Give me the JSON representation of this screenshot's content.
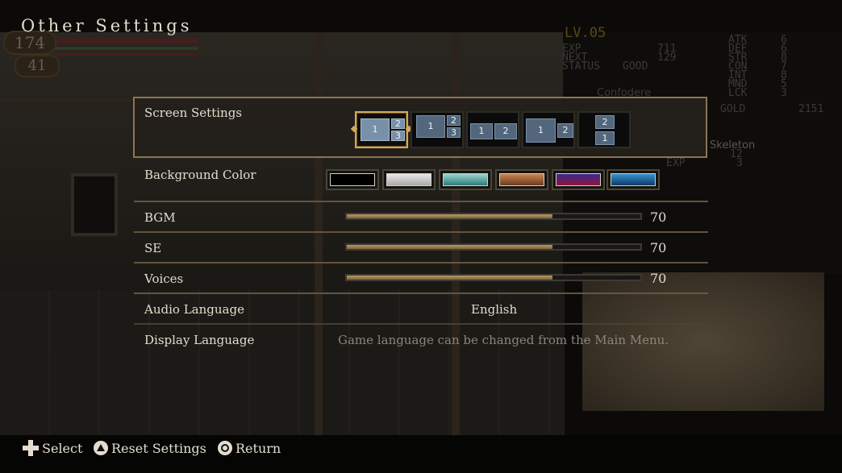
{
  "page_title": "Other Settings",
  "hud": {
    "hp": "174",
    "mp": "41"
  },
  "status_panel": {
    "level": "LV.05",
    "exp_label": "EXP",
    "exp_value": "711",
    "next_label": "NEXT",
    "next_value": "129",
    "status_label": "STATUS",
    "status_value": "GOOD",
    "stat_labels": [
      "ATK",
      "DEF",
      "STR",
      "CON",
      "INT",
      "MND",
      "LCK"
    ],
    "stat_values": [
      "6",
      "6",
      "8",
      "7",
      "8",
      "5",
      "3"
    ],
    "ally": "Confodere",
    "gold_label": "GOLD",
    "gold_value": "2151",
    "enemy_name": "Skeleton",
    "enemy_hp": "12",
    "enemy_exp_label": "EXP",
    "enemy_exp": "3"
  },
  "settings": {
    "screen_settings": {
      "label": "Screen Settings",
      "selected_index": 0,
      "options": [
        {
          "name": "layout-1-2-3",
          "cells": [
            "1",
            "2",
            "3"
          ]
        },
        {
          "name": "layout-1-2-3-alt",
          "cells": [
            "1",
            "2",
            "3"
          ]
        },
        {
          "name": "layout-1-2-equal",
          "cells": [
            "1",
            "2"
          ]
        },
        {
          "name": "layout-1-big-2-small",
          "cells": [
            "1",
            "2"
          ]
        },
        {
          "name": "layout-2-over-1",
          "cells": [
            "2",
            "1"
          ]
        }
      ]
    },
    "background_color": {
      "label": "Background Color",
      "swatches": [
        {
          "name": "black",
          "color": "#000000"
        },
        {
          "name": "gray",
          "color": "#cfcfcf"
        },
        {
          "name": "teal",
          "color": "#5fb3b3"
        },
        {
          "name": "brown",
          "color": "#a0603a"
        },
        {
          "name": "purple-red",
          "color": "#6b1c5a"
        },
        {
          "name": "blue",
          "color": "#1f6fa6"
        }
      ]
    },
    "bgm": {
      "label": "BGM",
      "value": "70",
      "level": 0.7
    },
    "se": {
      "label": "SE",
      "value": "70",
      "level": 0.7
    },
    "voices": {
      "label": "Voices",
      "value": "70",
      "level": 0.7
    },
    "audio_language": {
      "label": "Audio Language",
      "value": "English"
    },
    "display_language": {
      "label": "Display Language",
      "note": "Game language can be changed from the Main Menu."
    }
  },
  "footer": {
    "select_label": "Select",
    "reset_label": "Reset Settings",
    "return_label": "Return"
  }
}
